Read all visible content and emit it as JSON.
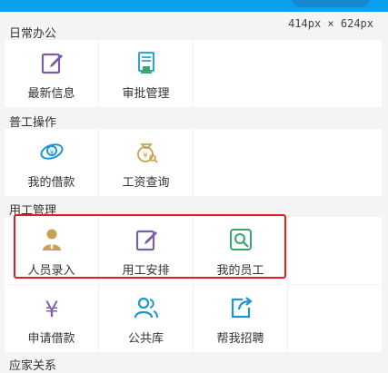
{
  "header": {
    "dimensions": "414px × 624px"
  },
  "sections": [
    {
      "title": "日常办公",
      "items": [
        {
          "label": "最新信息",
          "icon": "edit-note-icon"
        },
        {
          "label": "审批管理",
          "icon": "approval-document-icon"
        }
      ]
    },
    {
      "title": "普工操作",
      "items": [
        {
          "label": "我的借款",
          "icon": "loan-icon"
        },
        {
          "label": "工资查询",
          "icon": "salary-query-icon"
        }
      ]
    },
    {
      "title": "用工管理",
      "items": [
        {
          "label": "人员录入",
          "icon": "person-icon"
        },
        {
          "label": "用工安排",
          "icon": "schedule-edit-icon"
        },
        {
          "label": "我的员工",
          "icon": "search-employee-icon"
        },
        {
          "label": "申请借款",
          "icon": "yen-icon"
        },
        {
          "label": "公共库",
          "icon": "people-icon"
        },
        {
          "label": "帮我招聘",
          "icon": "share-icon"
        }
      ]
    },
    {
      "title": "应家关系"
    }
  ],
  "colors": {
    "top_bar": "#0aa0f0",
    "highlight": "#e02020",
    "purple": "#7b5ea7",
    "gold": "#c9a050",
    "green": "#3aa66a",
    "blue": "#1a96d6"
  }
}
